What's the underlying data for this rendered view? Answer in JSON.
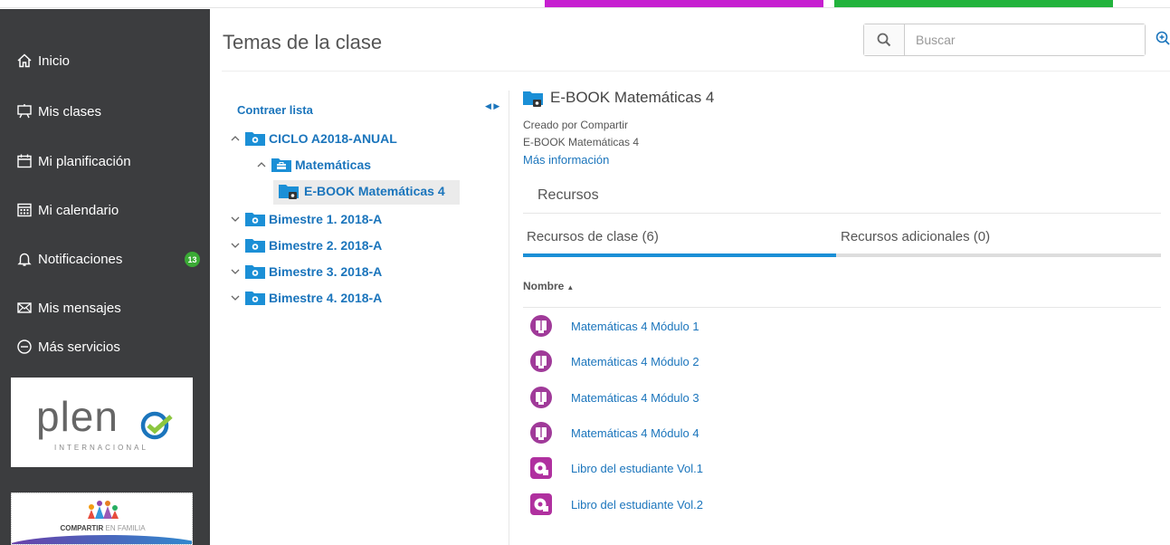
{
  "colors": {
    "sidebar_bg": "#3c3d3f",
    "accent": "#1b75bc",
    "tab_active": "#1b8fd6",
    "badge": "#3aaa35",
    "top_tab_magenta": "#c61fd0",
    "top_tab_green": "#22b33d",
    "resource_icon": "#a03a99"
  },
  "sidebar": {
    "items": [
      {
        "label": "Inicio",
        "icon": "home-icon"
      },
      {
        "label": "Mis clases",
        "icon": "chalkboard-icon"
      },
      {
        "label": "Mi planificación",
        "icon": "calendar-icon"
      },
      {
        "label": "Mi calendario",
        "icon": "calendar-grid-icon"
      },
      {
        "label": "Notificaciones",
        "icon": "bell-icon",
        "badge": "13"
      },
      {
        "label": "Mis mensajes",
        "icon": "mail-icon"
      },
      {
        "label": "Más servicios",
        "icon": "minus-circle-icon"
      }
    ],
    "logo_pleno": {
      "word": "plen",
      "sub": "INTERNACIONAL"
    },
    "logo_familia": {
      "text_bold": "COMPARTIR",
      "text_light": "EN FAMILIA"
    }
  },
  "header": {
    "title": "Temas de la clase",
    "search_placeholder": "Buscar"
  },
  "tree": {
    "collapse_label": "Contraer lista",
    "nodes": [
      {
        "label": "CICLO A2018-ANUAL",
        "expanded": true,
        "icon": "folder-camera-icon"
      },
      {
        "label": "Matemáticas",
        "expanded": true,
        "icon": "folder-briefcase-icon"
      },
      {
        "label": "E-BOOK Matemáticas 4",
        "selected": true,
        "icon": "folder-book-icon"
      },
      {
        "label": "Bimestre 1. 2018-A",
        "expanded": false,
        "icon": "folder-camera-icon"
      },
      {
        "label": "Bimestre 2. 2018-A",
        "expanded": false,
        "icon": "folder-camera-icon"
      },
      {
        "label": "Bimestre 3. 2018-A",
        "expanded": false,
        "icon": "folder-camera-icon"
      },
      {
        "label": "Bimestre 4. 2018-A",
        "expanded": false,
        "icon": "folder-camera-icon"
      }
    ]
  },
  "detail": {
    "title": "E-BOOK Matemáticas 4",
    "created_by": "Creado por Compartir",
    "subtitle": "E-BOOK Matemáticas 4",
    "more_info": "Más información",
    "section": "Recursos",
    "tabs": [
      {
        "label": "Recursos de clase (6)",
        "active": true
      },
      {
        "label": "Recursos adicionales (0)",
        "active": false
      }
    ],
    "column_name": "Nombre",
    "sort_arrow": "▲",
    "resources": [
      {
        "label": "Matemáticas 4 Módulo 1",
        "icon": "ebook-icon"
      },
      {
        "label": "Matemáticas 4 Módulo 2",
        "icon": "ebook-icon"
      },
      {
        "label": "Matemáticas 4 Módulo 3",
        "icon": "ebook-icon"
      },
      {
        "label": "Matemáticas 4 Módulo 4",
        "icon": "ebook-icon"
      },
      {
        "label": "Libro del estudiante Vol.1",
        "icon": "book-app-icon"
      },
      {
        "label": "Libro del estudiante Vol.2",
        "icon": "book-app-icon"
      }
    ]
  }
}
